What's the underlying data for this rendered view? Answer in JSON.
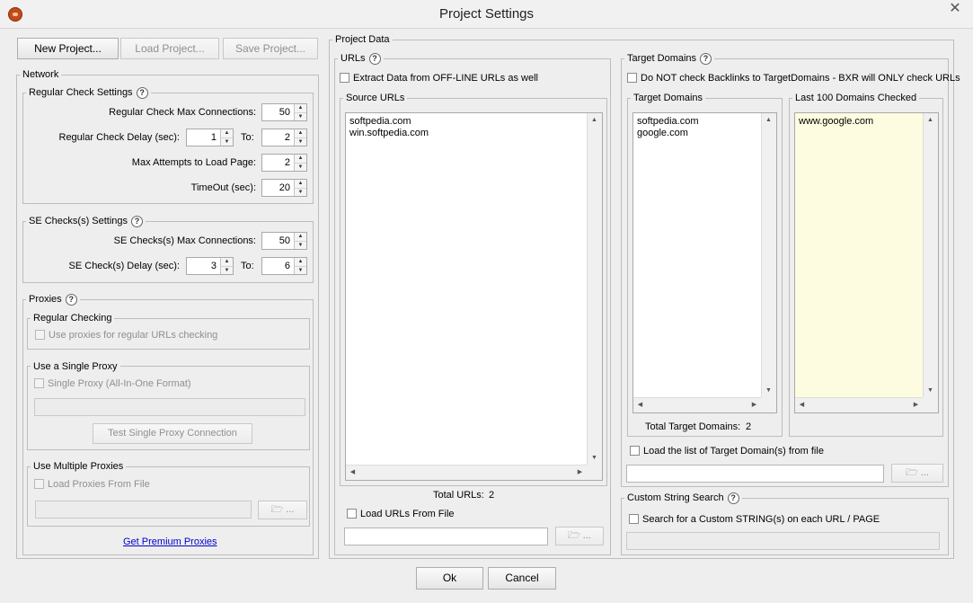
{
  "window": {
    "title": "Project Settings",
    "close": "✕"
  },
  "toolbar": {
    "new_project": "New Project...",
    "load_project": "Load Project...",
    "save_project": "Save Project..."
  },
  "network": {
    "title": "Network",
    "regular": {
      "title": "Regular Check Settings",
      "max_connections_label": "Regular Check Max Connections:",
      "max_connections": "50",
      "delay_label": "Regular Check Delay (sec):",
      "delay_from": "1",
      "to_label": "To:",
      "delay_to": "2",
      "max_attempts_label": "Max Attempts to Load Page:",
      "max_attempts": "2",
      "timeout_label": "TimeOut (sec):",
      "timeout": "20"
    },
    "se": {
      "title": "SE Checks(s) Settings",
      "max_connections_label": "SE Checks(s) Max Connections:",
      "max_connections": "50",
      "delay_label": "SE Check(s) Delay (sec):",
      "delay_from": "3",
      "to_label": "To:",
      "delay_to": "6"
    },
    "proxies": {
      "title": "Proxies",
      "regular_checking_title": "Regular Checking",
      "use_proxies_label": "Use proxies for regular URLs checking",
      "single_proxy_title": "Use a Single Proxy",
      "single_proxy_label": "Single Proxy (All-In-One Format)",
      "single_proxy_value": "",
      "test_button": "Test Single Proxy Connection",
      "multiple_title": "Use Multiple Proxies",
      "load_from_file_label": "Load Proxies From File",
      "file_value": "",
      "browse": "...",
      "premium_link": "Get Premium Proxies"
    }
  },
  "project_data": {
    "title": "Project Data",
    "urls": {
      "title": "URLs",
      "offline_label": "Extract Data from OFF-LINE URLs as well",
      "source_title": "Source URLs",
      "source_items": [
        "softpedia.com",
        "win.softpedia.com"
      ],
      "total_label": "Total URLs:",
      "total": "2",
      "load_file_label": "Load URLs From File",
      "file_value": "",
      "browse": "..."
    },
    "target": {
      "title": "Target Domains",
      "no_check_label": "Do NOT check Backlinks to TargetDomains - BXR will ONLY check URLs",
      "target_title": "Target Domains",
      "target_items": [
        "softpedia.com",
        "google.com"
      ],
      "last_title": "Last 100 Domains Checked",
      "last_items": [
        "www.google.com"
      ],
      "total_label": "Total Target Domains:",
      "total": "2",
      "load_file_label": "Load the list of Target Domain(s) from file",
      "file_value": "",
      "browse": "..."
    },
    "custom": {
      "title": "Custom String Search",
      "search_label": "Search for a Custom STRING(s) on each URL / PAGE",
      "value": ""
    }
  },
  "footer": {
    "ok": "Ok",
    "cancel": "Cancel"
  },
  "icons": {
    "help": "?",
    "up": "▲",
    "down": "▼",
    "left": "◀",
    "right": "▶",
    "folder": "folder-icon"
  }
}
